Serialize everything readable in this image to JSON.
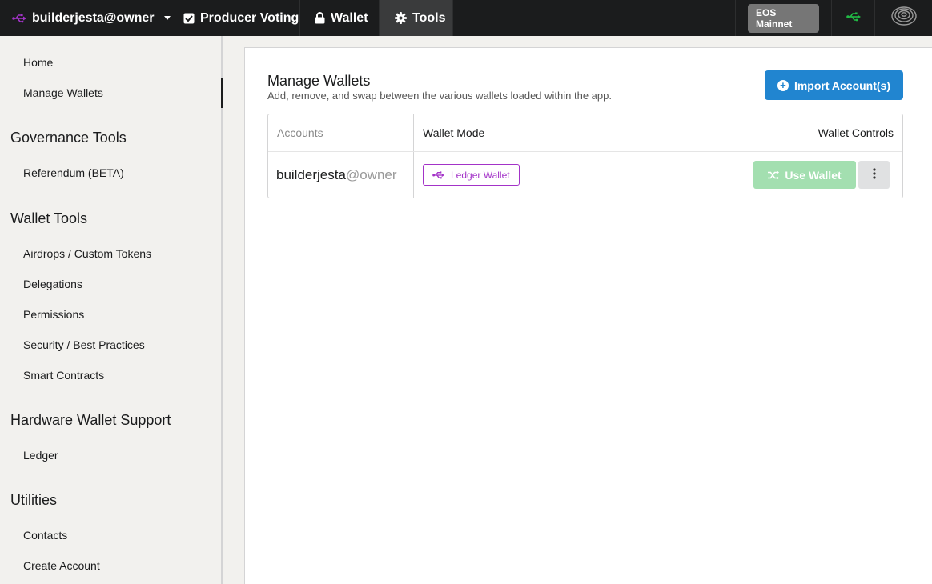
{
  "topbar": {
    "account": "builderjesta@owner",
    "tabs": [
      {
        "label": "Producer Voting",
        "icon": "checkbox-icon"
      },
      {
        "label": "Wallet",
        "icon": "lock-icon"
      },
      {
        "label": "Tools",
        "icon": "gear-icon",
        "active": true
      }
    ],
    "network": "EOS Mainnet",
    "usb_color": "#21ba45"
  },
  "sidebar": {
    "home": "Home",
    "manage_wallets": "Manage Wallets",
    "governance_heading": "Governance Tools",
    "referendum": "Referendum (BETA)",
    "wallet_tools_heading": "Wallet Tools",
    "airdrops": "Airdrops / Custom Tokens",
    "delegations": "Delegations",
    "permissions": "Permissions",
    "security": "Security / Best Practices",
    "smart_contracts": "Smart Contracts",
    "hardware_heading": "Hardware Wallet Support",
    "ledger": "Ledger",
    "utilities_heading": "Utilities",
    "contacts": "Contacts",
    "create_account": "Create Account"
  },
  "main": {
    "title": "Manage Wallets",
    "subtitle": "Add, remove, and swap between the various wallets loaded within the app.",
    "import_label": "Import Account(s)",
    "table": {
      "col_accounts": "Accounts",
      "col_mode": "Wallet Mode",
      "col_controls": "Wallet Controls",
      "rows": [
        {
          "account": "builderjesta",
          "authority": "@owner",
          "mode": "Ledger Wallet",
          "action": "Use Wallet"
        }
      ]
    }
  },
  "colors": {
    "accent_purple": "#a333c8",
    "primary_blue": "#2185d0",
    "use_wallet_green": "#a3dfb0"
  }
}
